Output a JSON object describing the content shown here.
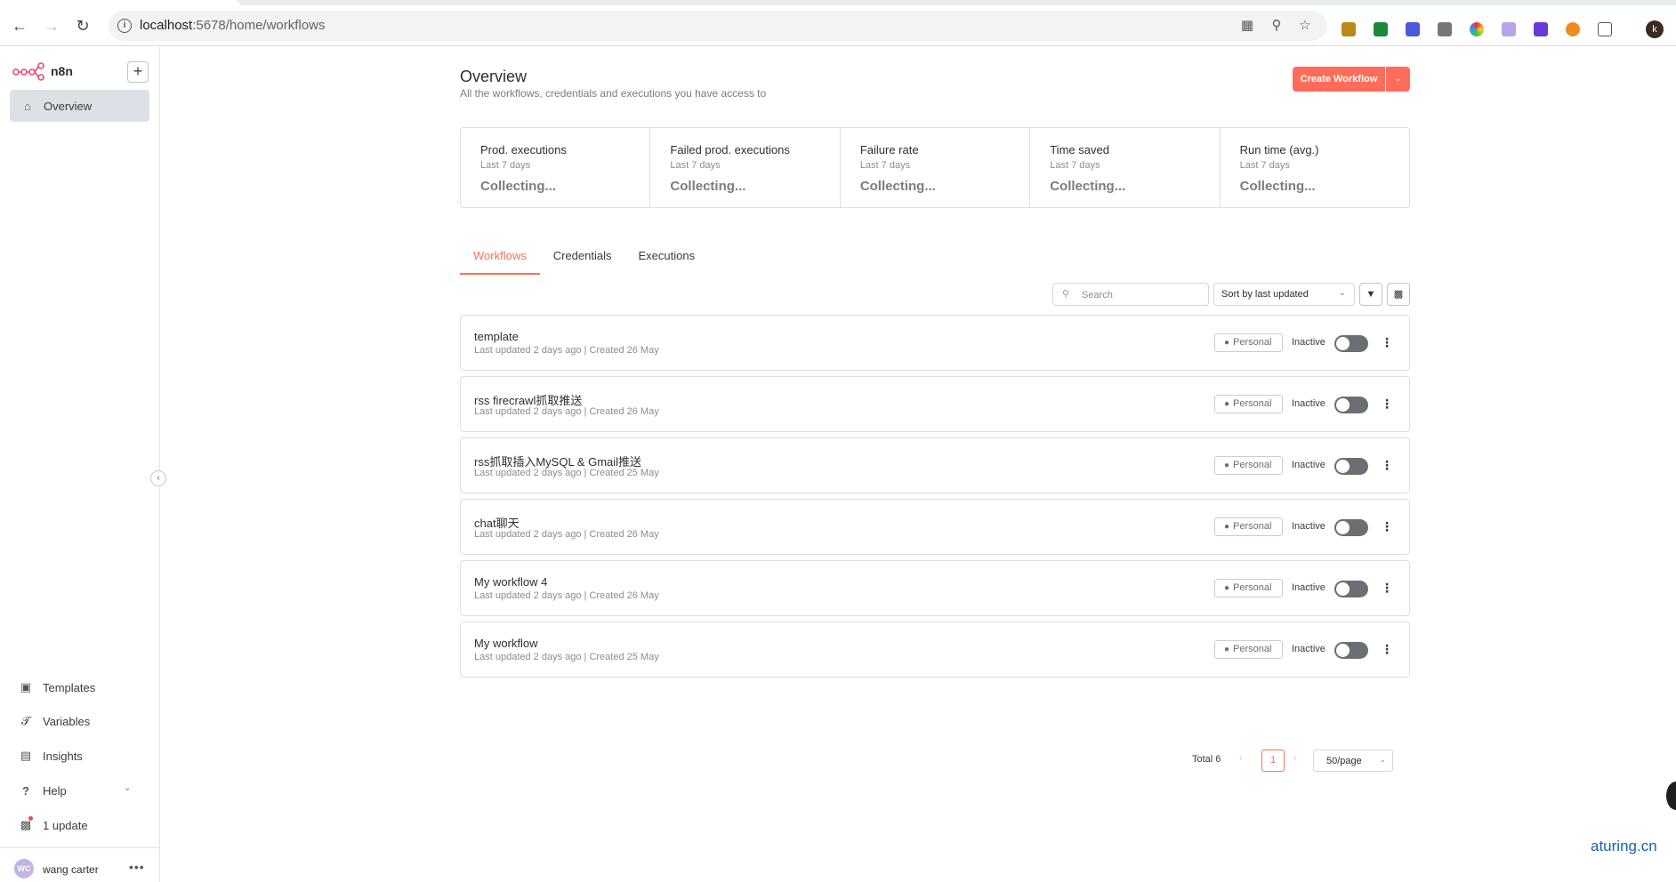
{
  "browser": {
    "url_host": "localhost",
    "url_rest": ":5678/home/workflows",
    "profile_initial": "k"
  },
  "sidebar": {
    "app_name": "n8n",
    "add_label": "+",
    "nav": [
      {
        "label": "Overview",
        "icon": "home-icon"
      }
    ],
    "bottom": [
      {
        "label": "Templates",
        "icon": "templates-icon"
      },
      {
        "label": "Variables",
        "icon": "variables-icon"
      },
      {
        "label": "Insights",
        "icon": "insights-icon"
      },
      {
        "label": "Help",
        "icon": "help-icon"
      },
      {
        "label": "1 update",
        "icon": "gift-icon"
      }
    ],
    "user": {
      "initials": "WC",
      "name": "wang carter"
    }
  },
  "header": {
    "title": "Overview",
    "subtitle": "All the workflows, credentials and executions you have access to",
    "create_label": "Create Workflow"
  },
  "stats": [
    {
      "title": "Prod. executions",
      "period": "Last 7 days",
      "value": "Collecting..."
    },
    {
      "title": "Failed prod. executions",
      "period": "Last 7 days",
      "value": "Collecting..."
    },
    {
      "title": "Failure rate",
      "period": "Last 7 days",
      "value": "Collecting..."
    },
    {
      "title": "Time saved",
      "period": "Last 7 days",
      "value": "Collecting..."
    },
    {
      "title": "Run time (avg.)",
      "period": "Last 7 days",
      "value": "Collecting..."
    }
  ],
  "tabs": [
    "Workflows",
    "Credentials",
    "Executions"
  ],
  "search": {
    "placeholder": "Search"
  },
  "sort": {
    "selected": "Sort by last updated"
  },
  "workflows": [
    {
      "name": "template",
      "meta": "Last updated 2 days ago | Created 26 May",
      "badge": "Personal",
      "status": "Inactive"
    },
    {
      "name": "rss firecrawl抓取推送",
      "meta": "Last updated 2 days ago | Created 26 May",
      "badge": "Personal",
      "status": "Inactive"
    },
    {
      "name": "rss抓取插入MySQL & Gmail推送",
      "meta": "Last updated 2 days ago | Created 25 May",
      "badge": "Personal",
      "status": "Inactive"
    },
    {
      "name": "chat聊天",
      "meta": "Last updated 2 days ago | Created 26 May",
      "badge": "Personal",
      "status": "Inactive"
    },
    {
      "name": "My workflow 4",
      "meta": "Last updated 2 days ago | Created 26 May",
      "badge": "Personal",
      "status": "Inactive"
    },
    {
      "name": "My workflow",
      "meta": "Last updated 2 days ago | Created 25 May",
      "badge": "Personal",
      "status": "Inactive"
    }
  ],
  "pagination": {
    "total": "Total 6",
    "current": "1",
    "page_size": "50/page"
  },
  "watermark": "aturing.cn",
  "colors": {
    "accent": "#ff6d5a",
    "toggle_off": "#6b6e72"
  }
}
